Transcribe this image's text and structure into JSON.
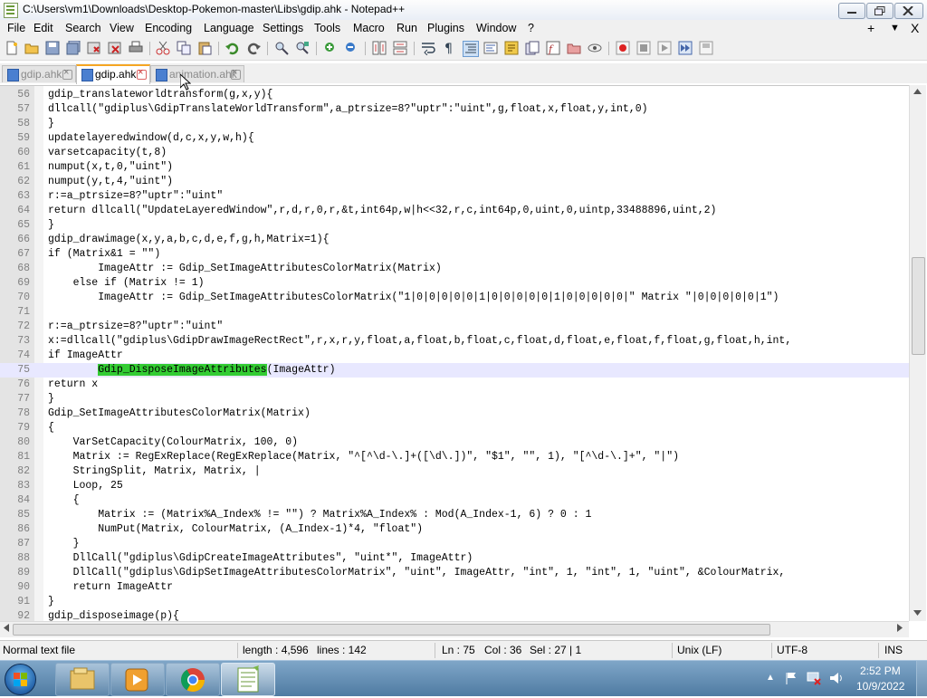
{
  "window": {
    "title": "C:\\Users\\vm1\\Downloads\\Desktop-Pokemon-master\\Libs\\gdip.ahk - Notepad++"
  },
  "menu": [
    "File",
    "Edit",
    "Search",
    "View",
    "Encoding",
    "Language",
    "Settings",
    "Tools",
    "Macro",
    "Run",
    "Plugins",
    "Window",
    "?"
  ],
  "menu_right": {
    "plus": "+",
    "down": "▼",
    "close": "X"
  },
  "tabs": [
    {
      "label": "gdip.ahk",
      "active": false
    },
    {
      "label": "gdip.ahk",
      "active": true
    },
    {
      "label": "animation.ahk",
      "active": false
    }
  ],
  "editor": {
    "current_line": "75",
    "highlight_word": "Gdip_DisposeImageAttributes",
    "lines": [
      {
        "n": "56",
        "text": "gdip_translateworldtransform(g,x,y){"
      },
      {
        "n": "57",
        "text": "dllcall(\"gdiplus\\GdipTranslateWorldTransform\",a_ptrsize=8?\"uptr\":\"uint\",g,float,x,float,y,int,0)"
      },
      {
        "n": "58",
        "text": "}"
      },
      {
        "n": "59",
        "text": "updatelayeredwindow(d,c,x,y,w,h){"
      },
      {
        "n": "60",
        "text": "varsetcapacity(t,8)"
      },
      {
        "n": "61",
        "text": "numput(x,t,0,\"uint\")"
      },
      {
        "n": "62",
        "text": "numput(y,t,4,\"uint\")"
      },
      {
        "n": "63",
        "text": "r:=a_ptrsize=8?\"uptr\":\"uint\""
      },
      {
        "n": "64",
        "text": "return dllcall(\"UpdateLayeredWindow\",r,d,r,0,r,&t,int64p,w|h<<32,r,c,int64p,0,uint,0,uintp,33488896,uint,2)"
      },
      {
        "n": "65",
        "text": "}"
      },
      {
        "n": "66",
        "text": "gdip_drawimage(x,y,a,b,c,d,e,f,g,h,Matrix=1){"
      },
      {
        "n": "67",
        "text": "if (Matrix&1 = \"\")"
      },
      {
        "n": "68",
        "text": "        ImageAttr := Gdip_SetImageAttributesColorMatrix(Matrix)"
      },
      {
        "n": "69",
        "text": "    else if (Matrix != 1)"
      },
      {
        "n": "70",
        "text": "        ImageAttr := Gdip_SetImageAttributesColorMatrix(\"1|0|0|0|0|0|1|0|0|0|0|0|1|0|0|0|0|0|\" Matrix \"|0|0|0|0|0|1\")"
      },
      {
        "n": "71",
        "text": ""
      },
      {
        "n": "72",
        "text": "r:=a_ptrsize=8?\"uptr\":\"uint\""
      },
      {
        "n": "73",
        "text": "x:=dllcall(\"gdiplus\\GdipDrawImageRectRect\",r,x,r,y,float,a,float,b,float,c,float,d,float,e,float,f,float,g,float,h,int,"
      },
      {
        "n": "74",
        "text": "if ImageAttr"
      },
      {
        "n": "75",
        "text": "        Gdip_DisposeImageAttributes(ImageAttr)"
      },
      {
        "n": "76",
        "text": "return x"
      },
      {
        "n": "77",
        "text": "}"
      },
      {
        "n": "78",
        "text": "Gdip_SetImageAttributesColorMatrix(Matrix)"
      },
      {
        "n": "79",
        "text": "{"
      },
      {
        "n": "80",
        "text": "    VarSetCapacity(ColourMatrix, 100, 0)"
      },
      {
        "n": "81",
        "text": "    Matrix := RegExReplace(RegExReplace(Matrix, \"^[^\\d-\\.]+([\\d\\.])\", \"$1\", \"\", 1), \"[^\\d-\\.]+\", \"|\")"
      },
      {
        "n": "82",
        "text": "    StringSplit, Matrix, Matrix, |"
      },
      {
        "n": "83",
        "text": "    Loop, 25"
      },
      {
        "n": "84",
        "text": "    {"
      },
      {
        "n": "85",
        "text": "        Matrix := (Matrix%A_Index% != \"\") ? Matrix%A_Index% : Mod(A_Index-1, 6) ? 0 : 1"
      },
      {
        "n": "86",
        "text": "        NumPut(Matrix, ColourMatrix, (A_Index-1)*4, \"float\")"
      },
      {
        "n": "87",
        "text": "    }"
      },
      {
        "n": "88",
        "text": "    DllCall(\"gdiplus\\GdipCreateImageAttributes\", \"uint*\", ImageAttr)"
      },
      {
        "n": "89",
        "text": "    DllCall(\"gdiplus\\GdipSetImageAttributesColorMatrix\", \"uint\", ImageAttr, \"int\", 1, \"int\", 1, \"uint\", &ColourMatrix,"
      },
      {
        "n": "90",
        "text": "    return ImageAttr"
      },
      {
        "n": "91",
        "text": "}"
      },
      {
        "n": "92",
        "text": "gdip_disposeimage(p){"
      }
    ]
  },
  "status": {
    "file_type": "Normal text file",
    "length": "length : 4,596",
    "lines": "lines : 142",
    "ln": "Ln : 75",
    "col": "Col : 36",
    "sel": "Sel : 27 | 1",
    "eol": "Unix (LF)",
    "encoding": "UTF-8",
    "mode": "INS"
  },
  "taskbar": {
    "time": "2:52 PM",
    "date": "10/9/2022",
    "tray_arrow": "▲"
  },
  "colors": {
    "highlight_green": "#33cc33",
    "current_line": "#e8e8ff",
    "active_tab_accent": "#f5a623"
  }
}
